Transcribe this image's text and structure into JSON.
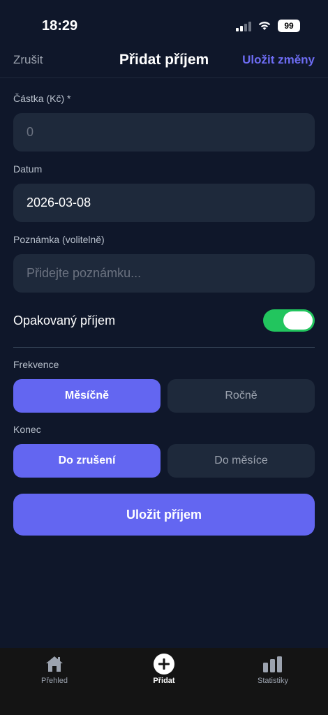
{
  "status_bar": {
    "time": "18:29",
    "battery": "99"
  },
  "header": {
    "cancel": "Zrušit",
    "title": "Přidat příjem",
    "save": "Uložit změny"
  },
  "form": {
    "amount": {
      "label": "Částka (Kč) *",
      "placeholder": "0"
    },
    "date": {
      "label": "Datum",
      "value": "2026-03-08"
    },
    "note": {
      "label": "Poznámka (volitelně)",
      "placeholder": "Přidejte poznámku..."
    },
    "recurring": {
      "label": "Opakovaný příjem",
      "on": true
    },
    "frequency": {
      "label": "Frekvence",
      "options": [
        "Měsíčně",
        "Ročně"
      ],
      "selected": "Měsíčně"
    },
    "end": {
      "label": "Konec",
      "options": [
        "Do zrušení",
        "Do měsíce"
      ],
      "selected": "Do zrušení"
    },
    "submit": "Uložit příjem"
  },
  "tabs": [
    {
      "label": "Přehled",
      "icon": "home-icon",
      "active": false
    },
    {
      "label": "Přidat",
      "icon": "plus-circle-icon",
      "active": true
    },
    {
      "label": "Statistiky",
      "icon": "bar-chart-icon",
      "active": false
    }
  ],
  "colors": {
    "accent": "#6366f1",
    "toggle_on": "#22c55e",
    "background": "#0f172a",
    "field": "#1e293b"
  }
}
